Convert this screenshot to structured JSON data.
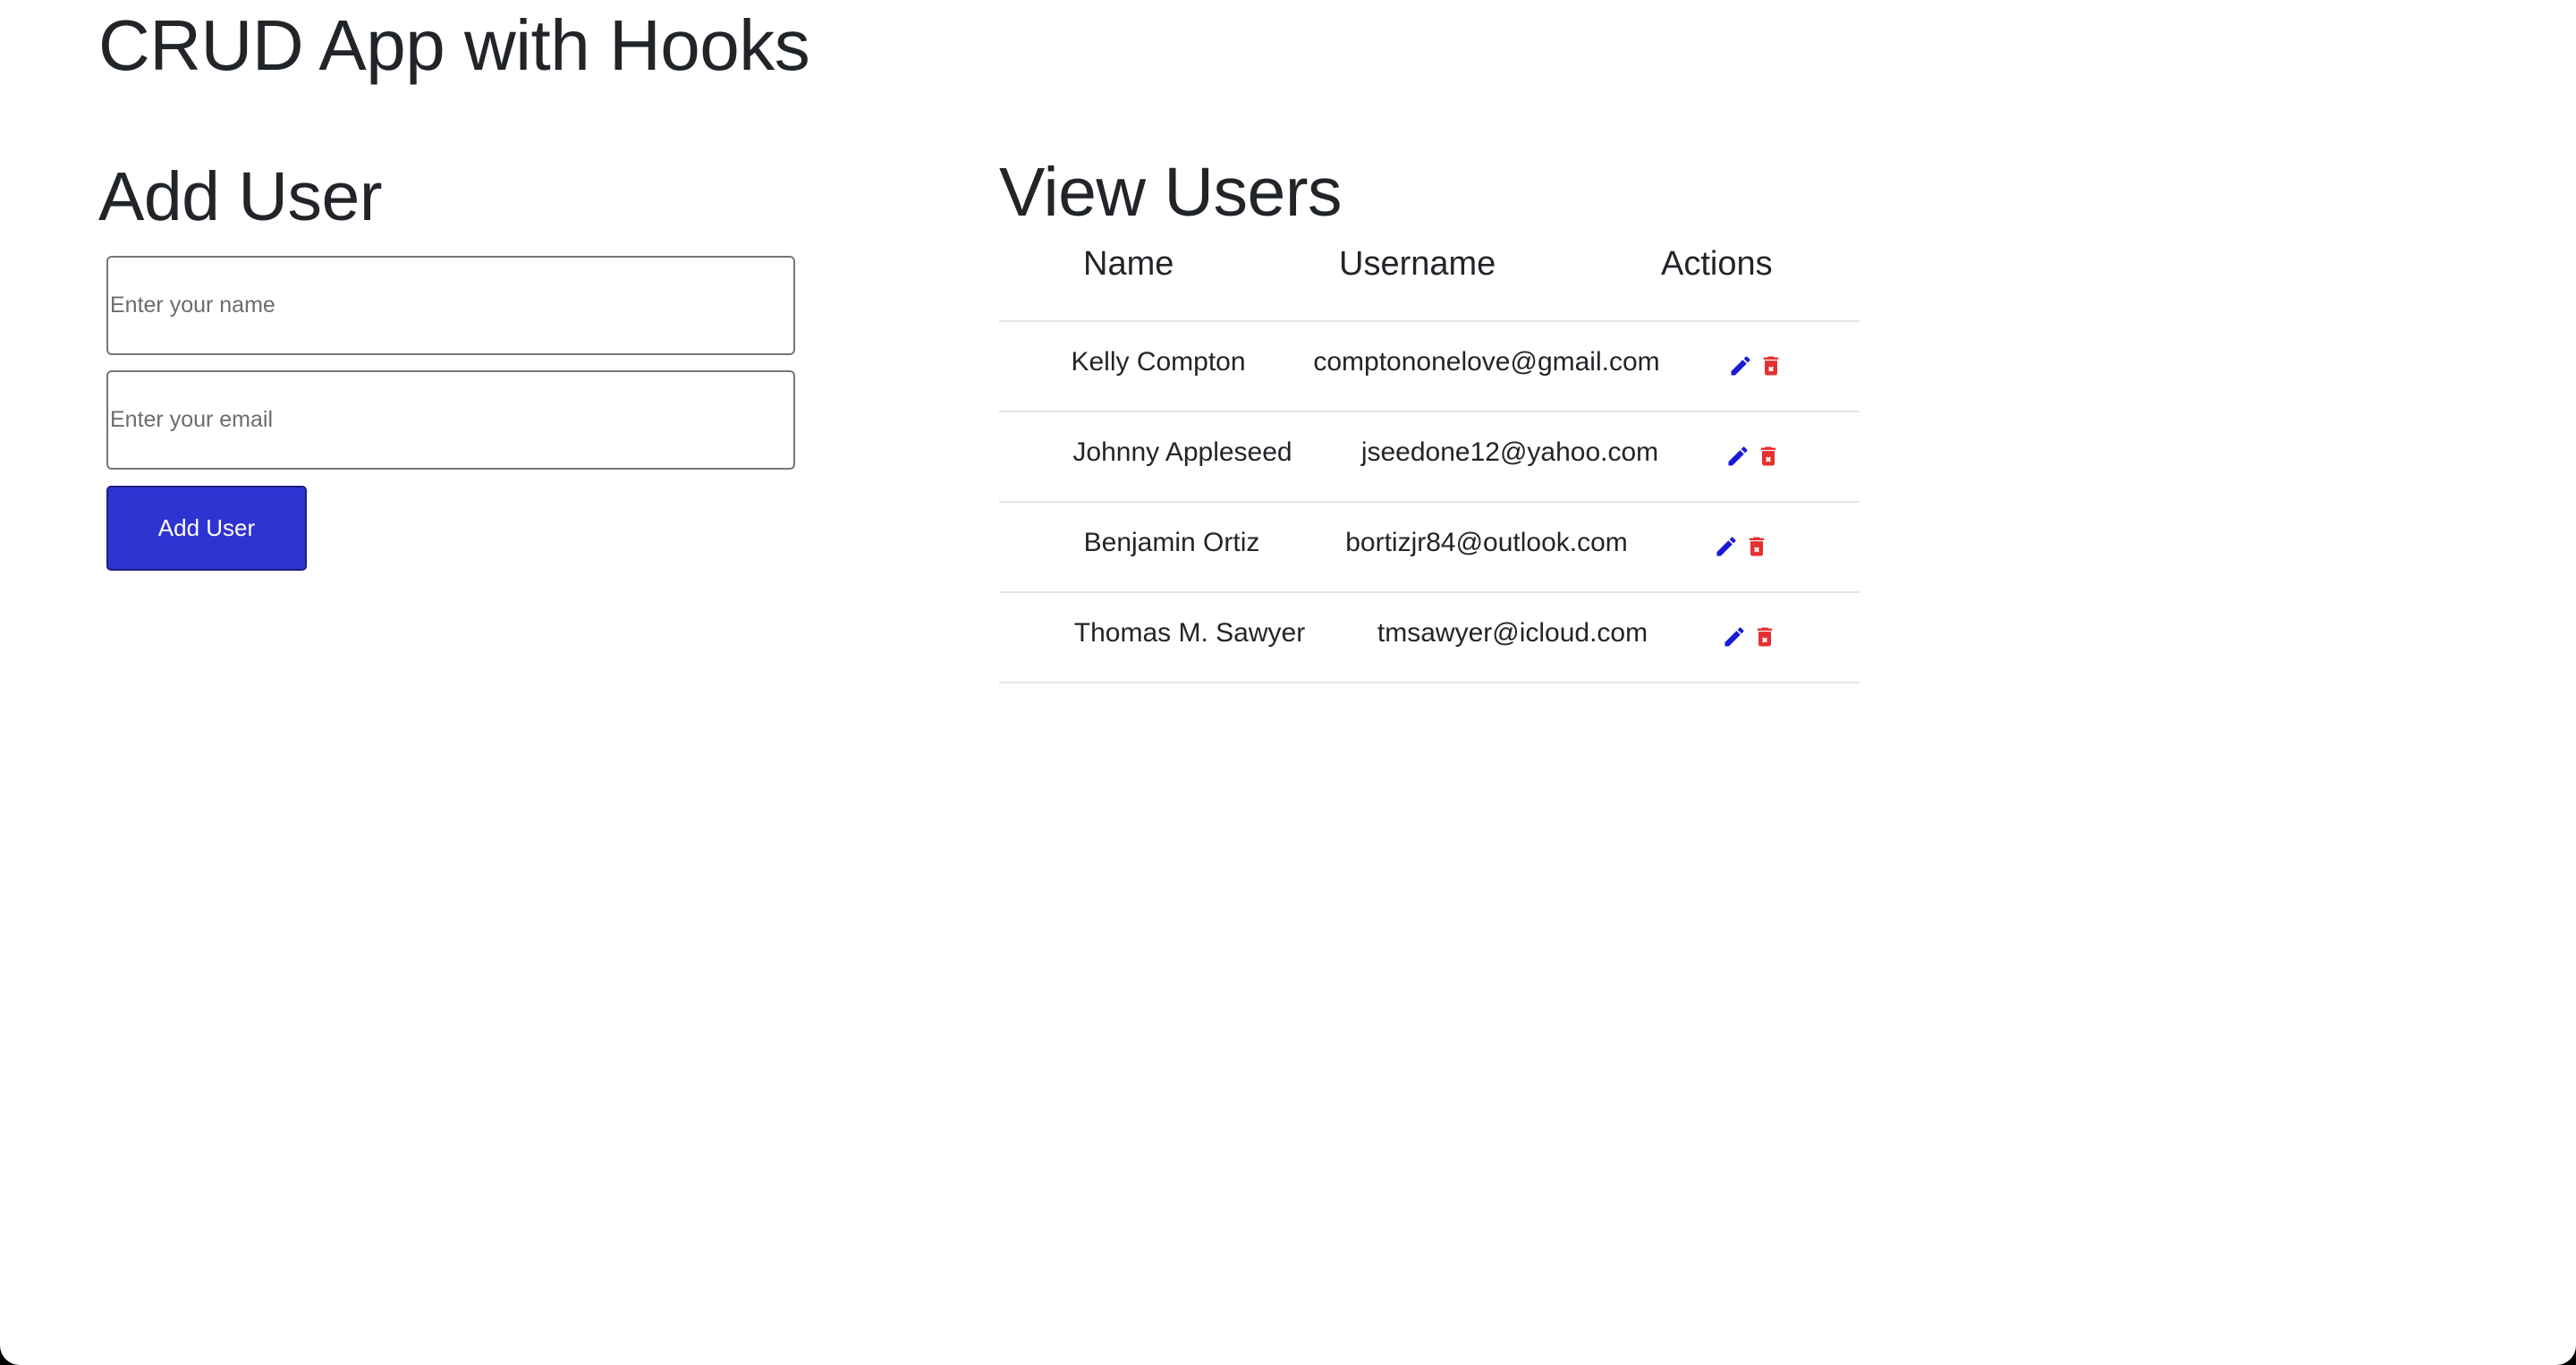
{
  "app": {
    "title": "CRUD App with Hooks"
  },
  "add_user": {
    "heading": "Add User",
    "name_placeholder": "Enter your name",
    "name_value": "",
    "email_placeholder": "Enter your email",
    "email_value": "",
    "button_label": "Add User"
  },
  "view_users": {
    "heading": "View Users",
    "columns": [
      "Name",
      "Username",
      "Actions"
    ],
    "rows": [
      {
        "name": "Kelly Compton",
        "username": "comptononelove@gmail.com"
      },
      {
        "name": "Johnny Appleseed",
        "username": "jseedone12@yahoo.com"
      },
      {
        "name": "Benjamin Ortiz",
        "username": "bortizjr84@outlook.com"
      },
      {
        "name": "Thomas M. Sawyer",
        "username": "tmsawyer@icloud.com"
      }
    ],
    "actions": {
      "edit_icon": "pencil-icon",
      "delete_icon": "trash-icon"
    }
  },
  "colors": {
    "primary_button": "#2e33d1",
    "edit_icon": "#1a1ad6",
    "delete_icon": "#e53030"
  }
}
